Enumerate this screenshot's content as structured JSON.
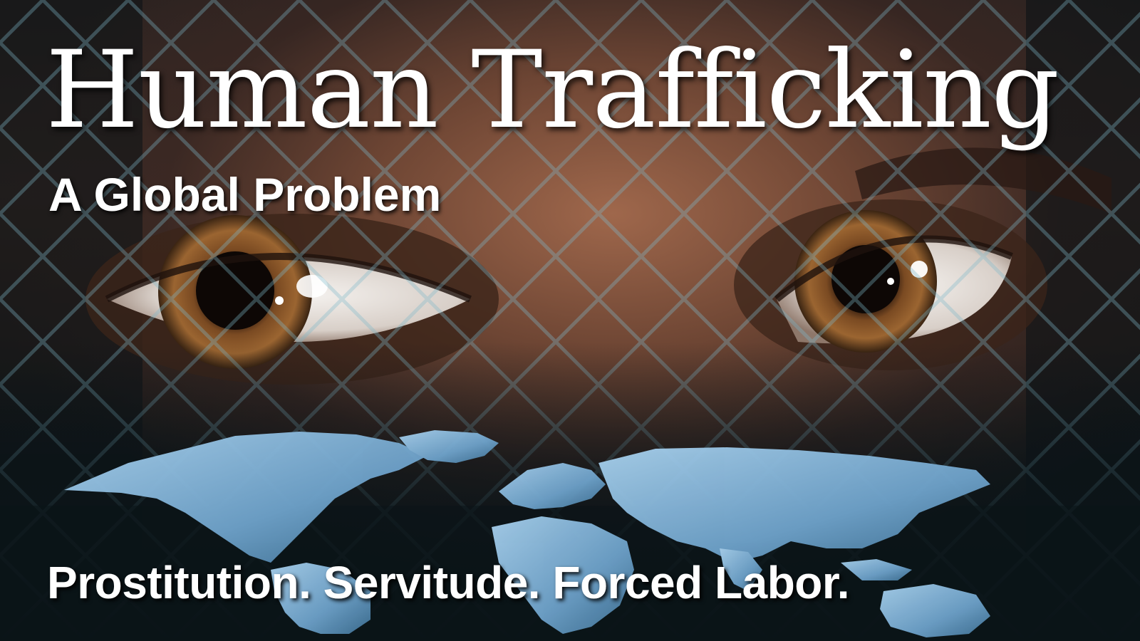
{
  "poster": {
    "title": "Human Trafficking",
    "subtitle": "A Global Problem",
    "tagline": "Prostitution. Servitude. Forced Labor."
  },
  "imagery": {
    "background": "close-up of a person's eyes",
    "overlay": "chain-link fence",
    "foreground": "world map"
  },
  "colors": {
    "text": "#ffffff",
    "skin": "#9a6a52",
    "map": "#7fb3da",
    "dark_band": "#0b1418"
  }
}
